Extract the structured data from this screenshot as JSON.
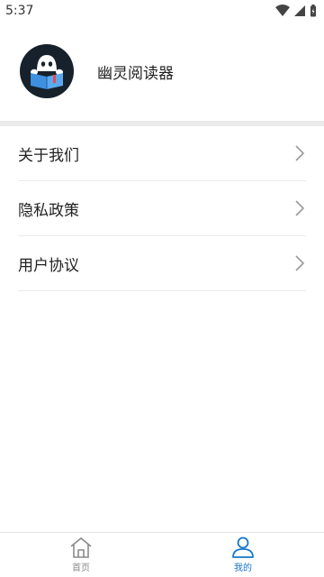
{
  "status_bar": {
    "time": "5:37"
  },
  "profile": {
    "app_name": "幽灵阅读器"
  },
  "menu": {
    "items": [
      {
        "label": "关于我们"
      },
      {
        "label": "隐私政策"
      },
      {
        "label": "用户协议"
      }
    ]
  },
  "tabbar": {
    "tabs": [
      {
        "label": "首页",
        "icon": "home-icon",
        "active": false
      },
      {
        "label": "我的",
        "icon": "user-icon",
        "active": true
      }
    ]
  },
  "colors": {
    "accent": "#1677cc",
    "inactive": "#8a8a8a",
    "divider": "#ebebeb",
    "avatar_bg": "#17212b"
  }
}
